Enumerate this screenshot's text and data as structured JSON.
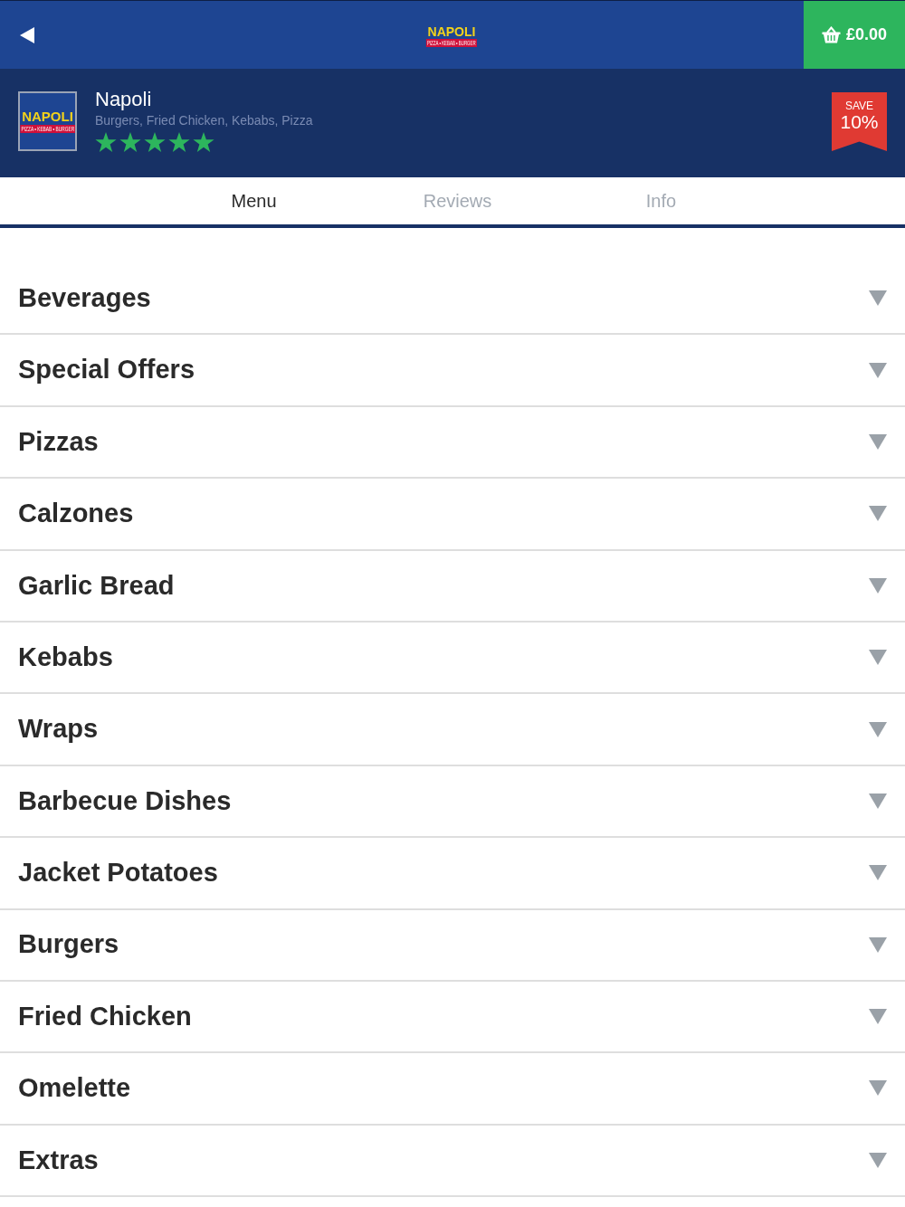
{
  "top_bar": {
    "logo": {
      "name": "NAPOLI",
      "tagline": "PIZZA • KEBAB • BURGER"
    },
    "basket": {
      "total": "£0.00"
    }
  },
  "restaurant": {
    "logo": {
      "name": "NAPOLI",
      "tagline": "PIZZA • KEBAB • BURGER"
    },
    "name": "Napoli",
    "cuisines": "Burgers, Fried Chicken, Kebabs, Pizza",
    "stars": 5,
    "offer": {
      "label": "SAVE",
      "value": "10%"
    }
  },
  "tabs": [
    {
      "label": "Menu",
      "selected": true
    },
    {
      "label": "Reviews",
      "selected": false
    },
    {
      "label": "Info",
      "selected": false
    }
  ],
  "categories": [
    {
      "label": "Beverages",
      "expanded": false
    },
    {
      "label": "Special Offers",
      "expanded": false
    },
    {
      "label": "Pizzas",
      "expanded": false
    },
    {
      "label": "Calzones",
      "expanded": false
    },
    {
      "label": "Garlic Bread",
      "expanded": false
    },
    {
      "label": "Kebabs",
      "expanded": false
    },
    {
      "label": "Wraps",
      "expanded": false
    },
    {
      "label": "Barbecue Dishes",
      "expanded": false
    },
    {
      "label": "Jacket Potatoes",
      "expanded": false
    },
    {
      "label": "Burgers",
      "expanded": false
    },
    {
      "label": "Fried Chicken",
      "expanded": false
    },
    {
      "label": "Omelette",
      "expanded": false
    },
    {
      "label": "Extras",
      "expanded": false
    }
  ]
}
